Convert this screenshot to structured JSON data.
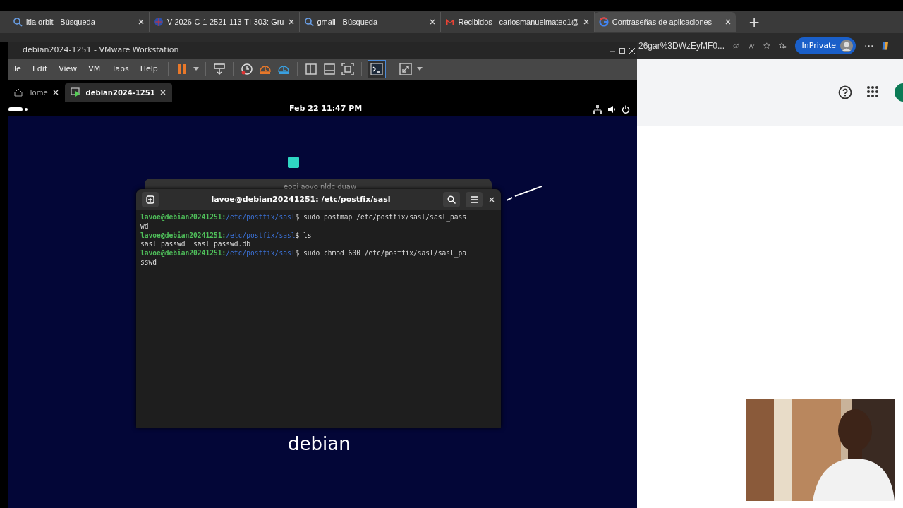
{
  "browser": {
    "tabs": [
      {
        "label": "itla orbit - Búsqueda",
        "kind": "search",
        "selected": false
      },
      {
        "label": "V-2026-C-1-2521-113-TI-303: Gru",
        "kind": "course",
        "selected": false
      },
      {
        "label": "gmail - Búsqueda",
        "kind": "search",
        "selected": false
      },
      {
        "label": "Recibidos - carlosmanuelmateo1@",
        "kind": "mail",
        "selected": false
      },
      {
        "label": "Contraseñas de aplicaciones",
        "kind": "google",
        "selected": true
      }
    ],
    "new_tab": "+",
    "address_text": "26gar%3DWzEyMF0...",
    "inprivate": "InPrivate",
    "more": "···"
  },
  "vmware": {
    "title": "debian2024-1251 - VMware Workstation",
    "menu": [
      "ile",
      "Edit",
      "View",
      "VM",
      "Tabs",
      "Help"
    ],
    "tabs": [
      {
        "label": "Home",
        "selected": false
      },
      {
        "label": "debian2024-1251",
        "selected": true
      }
    ],
    "guest": {
      "clock": "Feb 22  11:47 PM",
      "wallpaper_text": "debian",
      "back_window_title": "eopi aovo nldc duaw",
      "terminal": {
        "title": "lavoe@debian20241251: /etc/postfix/sasl",
        "lines": [
          {
            "kind": "prompt",
            "user": "lavoe@debian20241251:",
            "path": "/etc/postfix/sasl",
            "command": "$ sudo postmap /etc/postfix/sasl/sasl_pass"
          },
          {
            "kind": "output",
            "text": "wd"
          },
          {
            "kind": "prompt",
            "user": "lavoe@debian20241251:",
            "path": "/etc/postfix/sasl",
            "command": "$ ls"
          },
          {
            "kind": "output",
            "text": "sasl_passwd  sasl_passwd.db"
          },
          {
            "kind": "prompt",
            "user": "lavoe@debian20241251:",
            "path": "/etc/postfix/sasl",
            "command": "$ sudo chmod 600 /etc/postfix/sasl/sasl_pa"
          },
          {
            "kind": "output",
            "text": "sswd"
          }
        ]
      }
    }
  }
}
